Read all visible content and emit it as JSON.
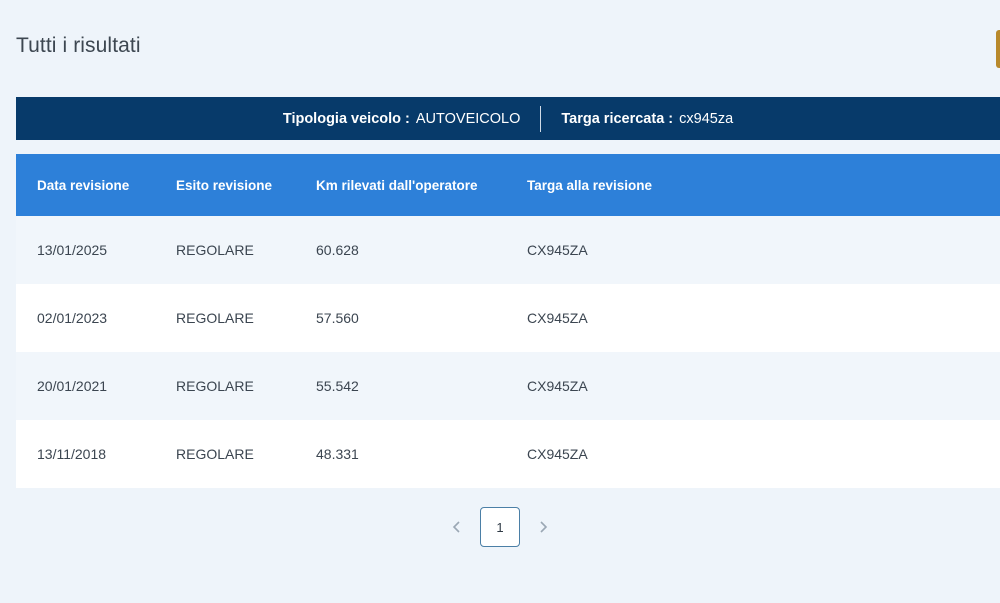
{
  "page": {
    "title": "Tutti i risultati"
  },
  "search_summary": {
    "vehicle_type_label": "Tipologia veicolo :",
    "vehicle_type_value": "AUTOVEICOLO",
    "plate_label": "Targa ricercata :",
    "plate_value": "cx945za"
  },
  "table": {
    "headers": [
      "Data revisione",
      "Esito revisione",
      "Km rilevati dall'operatore",
      "Targa alla revisione"
    ],
    "rows": [
      [
        "13/01/2025",
        "REGOLARE",
        "60.628",
        "CX945ZA"
      ],
      [
        "02/01/2023",
        "REGOLARE",
        "57.560",
        "CX945ZA"
      ],
      [
        "20/01/2021",
        "REGOLARE",
        "55.542",
        "CX945ZA"
      ],
      [
        "13/11/2018",
        "REGOLARE",
        "48.331",
        "CX945ZA"
      ]
    ]
  },
  "pagination": {
    "current_page": "1",
    "prev_icon": "chevron-left-icon",
    "next_icon": "chevron-right-icon"
  },
  "colors": {
    "header_bar": "#073a6a",
    "table_header": "#2d80d9",
    "background": "#eef4fa",
    "accent_button": "#b8892b"
  }
}
